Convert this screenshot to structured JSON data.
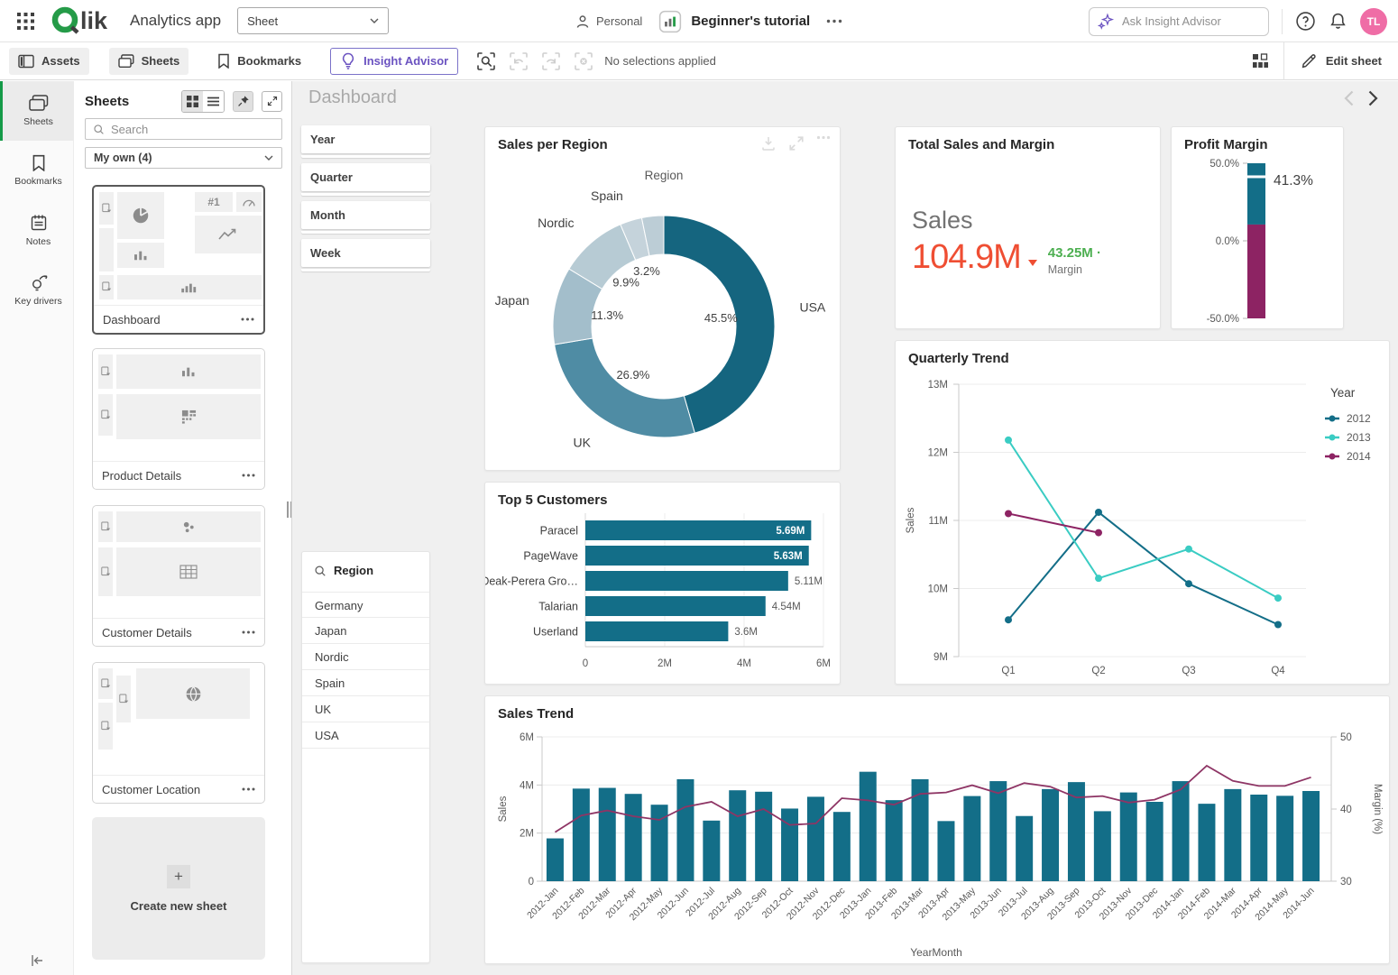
{
  "topbar": {
    "app_title": "Analytics app",
    "sheet_selector_value": "Sheet",
    "personal_label": "Personal",
    "app_name": "Beginner's tutorial",
    "ask_placeholder": "Ask Insight Advisor",
    "avatar_initials": "TL"
  },
  "toolbar": {
    "assets_label": "Assets",
    "sheets_label": "Sheets",
    "bookmarks_label": "Bookmarks",
    "insight_advisor_label": "Insight Advisor",
    "selection_status": "No selections applied",
    "edit_sheet_label": "Edit sheet"
  },
  "left_rail": {
    "items": [
      {
        "label": "Sheets",
        "active": true
      },
      {
        "label": "Bookmarks",
        "active": false
      },
      {
        "label": "Notes",
        "active": false
      },
      {
        "label": "Key drivers",
        "active": false
      }
    ]
  },
  "sheets_panel": {
    "title": "Sheets",
    "search_placeholder": "Search",
    "group_selector_value": "My own (4)",
    "thumb_badge": "#1",
    "cards": [
      {
        "title": "Dashboard"
      },
      {
        "title": "Product Details"
      },
      {
        "title": "Customer Details"
      },
      {
        "title": "Customer Location"
      }
    ],
    "create_new_label": "Create new sheet"
  },
  "sheet": {
    "title": "Dashboard",
    "filters": [
      "Year",
      "Quarter",
      "Month",
      "Week"
    ],
    "region_filter": {
      "title": "Region",
      "values": [
        "Germany",
        "Japan",
        "Nordic",
        "Spain",
        "UK",
        "USA"
      ]
    }
  },
  "chart_data": {
    "sales_per_region": {
      "type": "pie",
      "title": "Sales per Region",
      "dimension_label": "Region",
      "slices": [
        {
          "label": "USA",
          "pct": 45.5,
          "pct_label": "45.5%",
          "color": "#15657F",
          "show_name": true,
          "show_pct": true
        },
        {
          "label": "UK",
          "pct": 26.9,
          "pct_label": "26.9%",
          "color": "#4F8CA4",
          "show_name": true,
          "show_pct": true
        },
        {
          "label": "Japan",
          "pct": 11.3,
          "pct_label": "11.3%",
          "color": "#A3BECB",
          "show_name": true,
          "show_pct": true
        },
        {
          "label": "Nordic",
          "pct": 9.9,
          "pct_label": "9.9%",
          "color": "#B7CBD4",
          "show_name": true,
          "show_pct": true
        },
        {
          "label": "Spain",
          "pct": 3.2,
          "pct_label": "3.2%",
          "color": "#C5D3DB",
          "show_name": true,
          "show_pct": true
        },
        {
          "label": "Germany",
          "pct": 3.2,
          "pct_label": "3.2%",
          "color": "#BCCDD6",
          "show_name": false,
          "show_pct": false
        }
      ]
    },
    "top_5_customers": {
      "type": "bar",
      "orientation": "horizontal",
      "title": "Top 5 Customers",
      "categories": [
        "Paracel",
        "PageWave",
        "Deak-Perera Gro…",
        "Talarian",
        "Userland"
      ],
      "values": [
        5.69,
        5.63,
        5.11,
        4.54,
        3.6
      ],
      "value_labels": [
        "5.69M",
        "5.63M",
        "5.11M",
        "4.54M",
        "3.6M"
      ],
      "label_inside": [
        true,
        true,
        false,
        false,
        false
      ],
      "xlim": [
        0,
        6
      ],
      "x_ticks": [
        {
          "value": 0,
          "label": "0"
        },
        {
          "value": 2,
          "label": "2M"
        },
        {
          "value": 4,
          "label": "4M"
        },
        {
          "value": 6,
          "label": "6M"
        }
      ],
      "bar_color": "#136E88"
    },
    "total_sales_margin": {
      "type": "kpi",
      "title": "Total Sales and Margin",
      "sales_label": "Sales",
      "sales_value": "104.9M",
      "margin_value": "43.25M ·",
      "margin_label": "Margin",
      "sales_color": "#EF4E33",
      "margin_color": "#4DAF51"
    },
    "profit_margin": {
      "type": "gauge",
      "title": "Profit Margin",
      "value": 41.3,
      "value_label": "41.3%",
      "min": -50,
      "max": 50,
      "axis_ticks": [
        {
          "value": 50,
          "label": "50.0%"
        },
        {
          "value": 0,
          "label": "0.0%"
        },
        {
          "value": -50,
          "label": "-50.0%"
        }
      ],
      "segments": [
        {
          "from": 50,
          "to": 10.5,
          "color": "#136E88"
        },
        {
          "from": 10.5,
          "to": -50,
          "color": "#8D2363"
        }
      ]
    },
    "quarterly_trend": {
      "type": "line",
      "title": "Quarterly Trend",
      "ylabel": "Sales",
      "ylim": [
        9,
        13
      ],
      "y_ticks": [
        {
          "value": 9,
          "label": "9M"
        },
        {
          "value": 10,
          "label": "10M"
        },
        {
          "value": 11,
          "label": "11M"
        },
        {
          "value": 12,
          "label": "12M"
        },
        {
          "value": 13,
          "label": "13M"
        }
      ],
      "categories": [
        "Q1",
        "Q2",
        "Q3",
        "Q4"
      ],
      "legend_title": "Year",
      "series": [
        {
          "name": "2012",
          "color": "#136E88",
          "values": [
            9.54,
            11.12,
            10.07,
            9.47
          ]
        },
        {
          "name": "2013",
          "color": "#3ACCC3",
          "values": [
            12.18,
            10.15,
            10.58,
            9.86
          ]
        },
        {
          "name": "2014",
          "color": "#8D2363",
          "values": [
            11.1,
            10.82,
            null,
            null
          ]
        }
      ]
    },
    "sales_trend": {
      "type": "combo",
      "title": "Sales Trend",
      "xlabel": "YearMonth",
      "ylabel_left": "Sales",
      "ylabel_right": "Margin (%)",
      "ylim_left": [
        0,
        6
      ],
      "y_ticks_left": [
        {
          "value": 0,
          "label": "0"
        },
        {
          "value": 2,
          "label": "2M"
        },
        {
          "value": 4,
          "label": "4M"
        },
        {
          "value": 6,
          "label": "6M"
        }
      ],
      "ylim_right": [
        30,
        50
      ],
      "y_ticks_right": [
        {
          "value": 30,
          "label": "30"
        },
        {
          "value": 40,
          "label": "40"
        },
        {
          "value": 50,
          "label": "50"
        }
      ],
      "categories": [
        "2012-Jan",
        "2012-Feb",
        "2012-Mar",
        "2012-Apr",
        "2012-May",
        "2012-Jun",
        "2012-Jul",
        "2012-Aug",
        "2012-Sep",
        "2012-Oct",
        "2012-Nov",
        "2012-Dec",
        "2013-Jan",
        "2013-Feb",
        "2013-Mar",
        "2013-Apr",
        "2013-May",
        "2013-Jun",
        "2013-Jul",
        "2013-Aug",
        "2013-Sep",
        "2013-Oct",
        "2013-Nov",
        "2013-Dec",
        "2014-Jan",
        "2014-Feb",
        "2014-Mar",
        "2014-Apr",
        "2014-May",
        "2014-Jun"
      ],
      "bars": {
        "name": "Sales",
        "color": "#136E88",
        "values": [
          1.78,
          3.85,
          3.88,
          3.63,
          3.18,
          4.24,
          2.52,
          3.78,
          3.72,
          3.02,
          3.51,
          2.88,
          4.55,
          3.37,
          4.24,
          2.5,
          3.54,
          4.16,
          2.71,
          3.83,
          4.12,
          2.91,
          3.69,
          3.3,
          4.16,
          3.22,
          3.83,
          3.6,
          3.55,
          3.75
        ]
      },
      "line": {
        "name": "Margin",
        "color": "#8E3565",
        "values": [
          36.8,
          39.1,
          39.8,
          39.0,
          38.5,
          40.3,
          41.0,
          39.0,
          40.0,
          37.8,
          38.0,
          41.5,
          41.2,
          40.6,
          42.1,
          42.3,
          43.3,
          42.2,
          43.6,
          43.1,
          41.6,
          41.8,
          40.9,
          41.3,
          42.7,
          46.0,
          43.9,
          43.2,
          43.2,
          44.4
        ]
      }
    }
  }
}
